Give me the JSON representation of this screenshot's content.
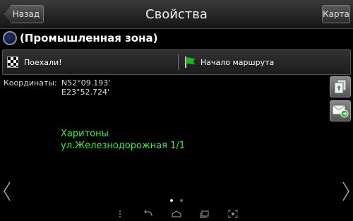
{
  "header": {
    "back_label": "Назад",
    "title": "Свойства",
    "map_label": "Карта"
  },
  "place": {
    "name": "(Промышленная зона)",
    "icon": "globe-icon"
  },
  "actions": {
    "go_label": "Поехали!",
    "go_icon": "checkered-flag-icon",
    "route_label": "Начало маршрута",
    "route_icon": "green-flag-icon"
  },
  "coordinates": {
    "label": "Координаты:",
    "lat": "N52°09.193'",
    "lon": "E23°52.724'"
  },
  "side_buttons": [
    "copy-icon",
    "email-icon"
  ],
  "address": {
    "line1": "Харитоны",
    "line2": "ул.Железнодорожная 1/1"
  },
  "pager": {
    "pages": 2,
    "current": 1
  },
  "colors": {
    "address_text": "#3cf045",
    "background": "#000000",
    "toolbar": "#2a2a2a"
  }
}
